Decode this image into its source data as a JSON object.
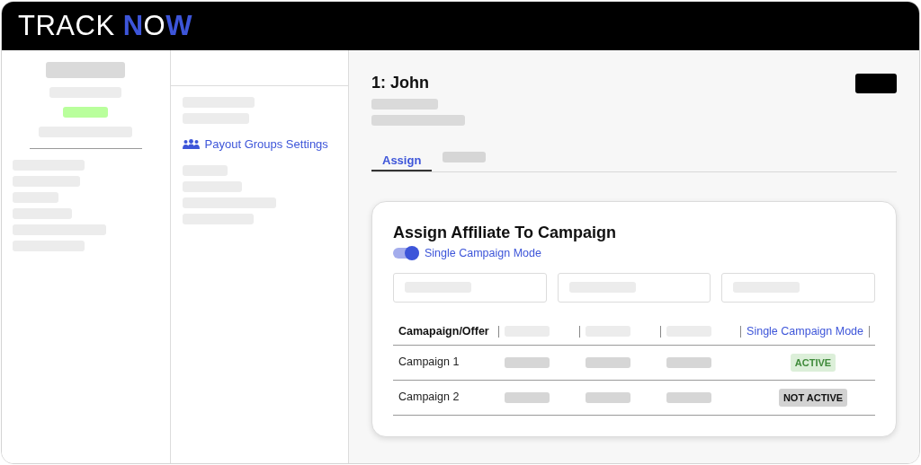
{
  "logo": {
    "parts": [
      {
        "text": "TRACK ",
        "accent": false
      },
      {
        "text": "N",
        "accent": true
      },
      {
        "text": "O",
        "accent": false
      },
      {
        "text": "W",
        "accent": true
      }
    ]
  },
  "menu_link": {
    "label": "Payout Groups Settings"
  },
  "page": {
    "title": "1: John"
  },
  "tabs": [
    {
      "label": "Assign",
      "selected": true
    },
    {
      "kind": "placeholder",
      "selected": false
    }
  ],
  "card": {
    "title": "Assign Affiliate To Campaign",
    "toggle": {
      "label": "Single Campaign Mode",
      "on": true
    }
  },
  "table": {
    "columns": [
      {
        "label": "Camapaign/Offer",
        "kind": "text"
      },
      {
        "kind": "placeholder"
      },
      {
        "kind": "placeholder"
      },
      {
        "kind": "placeholder"
      },
      {
        "label": "Single Campaign Mode",
        "kind": "link"
      }
    ],
    "rows": [
      {
        "name": "Campaign 1",
        "status": {
          "label": "ACTIVE",
          "active": true
        }
      },
      {
        "name": "Campaign 2",
        "status": {
          "label": "NOT ACTIVE",
          "active": false
        }
      }
    ]
  }
}
